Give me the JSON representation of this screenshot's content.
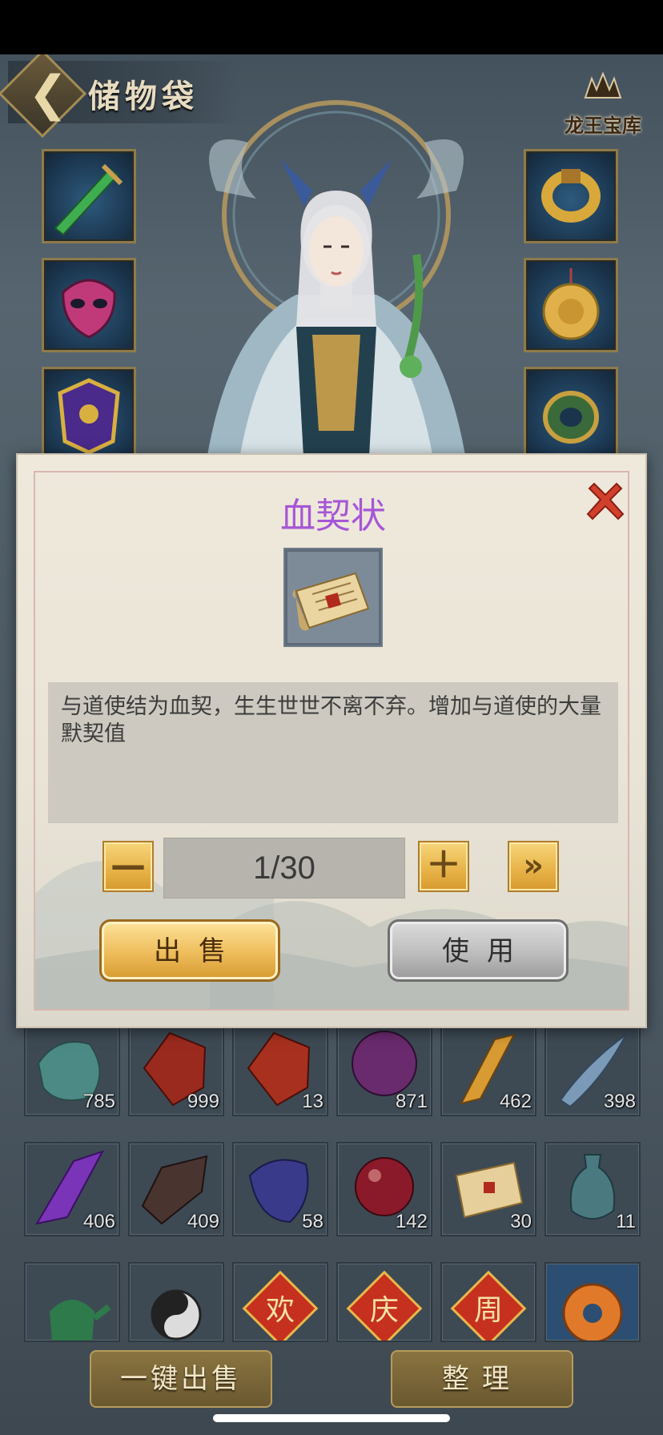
{
  "header": {
    "title": "储物袋",
    "treasury_label": "龙王宝库"
  },
  "equipment": {
    "left": [
      {
        "icon": "sword-icon"
      },
      {
        "icon": "mask-icon"
      },
      {
        "icon": "armor-icon"
      }
    ],
    "right": [
      {
        "icon": "gold-ring-icon"
      },
      {
        "icon": "gold-pendant-icon"
      },
      {
        "icon": "jade-bracelet-icon"
      }
    ]
  },
  "inventory": {
    "rows": [
      [
        {
          "icon": "teal-stone-icon",
          "count": "785"
        },
        {
          "icon": "red-crystal-icon",
          "count": "999"
        },
        {
          "icon": "red-crystal-icon",
          "count": "13"
        },
        {
          "icon": "purple-gem-icon",
          "count": "871"
        },
        {
          "icon": "amber-shard-icon",
          "count": "462"
        },
        {
          "icon": "blue-feather-icon",
          "count": "398"
        }
      ],
      [
        {
          "icon": "violet-crystal-icon",
          "count": "406"
        },
        {
          "icon": "dark-ore-icon",
          "count": "409"
        },
        {
          "icon": "swirl-stone-icon",
          "count": "58"
        },
        {
          "icon": "red-orb-icon",
          "count": "142"
        },
        {
          "icon": "scroll-icon",
          "count": "30"
        },
        {
          "icon": "vase-icon",
          "count": "11"
        }
      ],
      [
        {
          "icon": "jade-teapot-icon",
          "count": ""
        },
        {
          "icon": "yinyang-gourd-icon",
          "count": ""
        },
        {
          "icon": "festival-card-icon",
          "glyph": "欢",
          "count": ""
        },
        {
          "icon": "festival-card-icon",
          "glyph": "庆",
          "count": ""
        },
        {
          "icon": "festival-card-icon",
          "glyph": "周",
          "count": ""
        },
        {
          "icon": "orange-disc-icon",
          "count": ""
        }
      ]
    ]
  },
  "buttons": {
    "sell_all": "一键出售",
    "organize": "整理"
  },
  "modal": {
    "title": "血契状",
    "item_icon": "scroll-icon",
    "description": "与道使结为血契，生生世世不离不弃。增加与道使的大量默契值",
    "quantity": "1/30",
    "quantity_current": 1,
    "quantity_max": 30,
    "sell_label": "出售",
    "use_label": "使用"
  },
  "colors": {
    "title_purple": "#a656d6",
    "close_red": "#d0402c",
    "gold_button": "#e7b247",
    "gray_button": "#bdbdbd"
  }
}
